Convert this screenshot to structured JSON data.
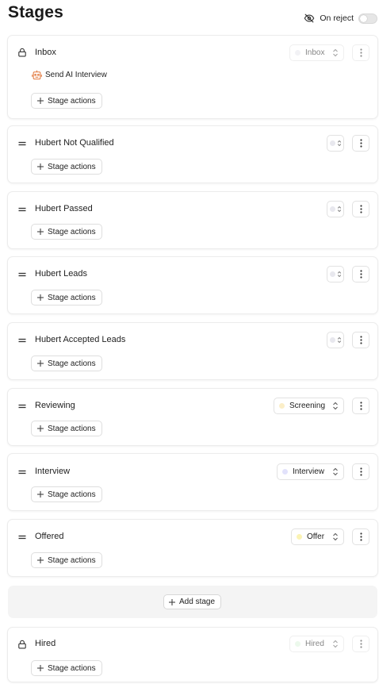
{
  "page": {
    "title": "Stages"
  },
  "on_reject": {
    "label": "On reject",
    "enabled": false
  },
  "common": {
    "stage_actions_label": "Stage actions",
    "add_stage_label": "Add stage"
  },
  "stages": [
    {
      "name": "Inbox",
      "locked": true,
      "select": {
        "label": "Inbox",
        "dot": "#e8e8ee"
      },
      "automation": {
        "label": "Send AI Interview",
        "icon": "robot-icon"
      }
    },
    {
      "name": "Hubert Not Qualified",
      "locked": false,
      "select": {
        "label": "",
        "dot": "#e8e8ee"
      }
    },
    {
      "name": "Hubert Passed",
      "locked": false,
      "select": {
        "label": "",
        "dot": "#e8e8ee"
      }
    },
    {
      "name": "Hubert Leads",
      "locked": false,
      "select": {
        "label": "",
        "dot": "#e8e8ee"
      }
    },
    {
      "name": "Hubert Accepted Leads",
      "locked": false,
      "select": {
        "label": "",
        "dot": "#e8e8ee"
      }
    },
    {
      "name": "Reviewing",
      "locked": false,
      "select": {
        "label": "Screening",
        "dot": "#fbeec8"
      }
    },
    {
      "name": "Interview",
      "locked": false,
      "select": {
        "label": "Interview",
        "dot": "#e2e2fb"
      }
    },
    {
      "name": "Offered",
      "locked": false,
      "select": {
        "label": "Offer",
        "dot": "#fbf3b4"
      }
    },
    {
      "name": "Hired",
      "locked": true,
      "select": {
        "label": "Hired",
        "dot": "#ddf5dd"
      }
    }
  ],
  "colors": {
    "automation_icon": "#e2773b",
    "toggle_off": "#e6e6e6"
  }
}
